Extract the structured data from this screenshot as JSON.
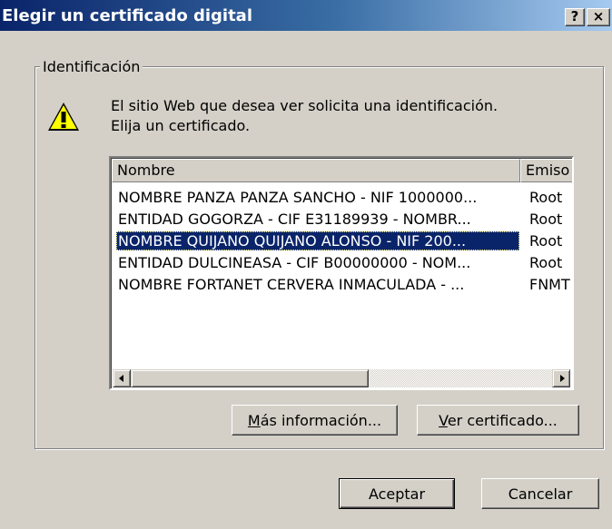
{
  "window": {
    "title": "Elegir un certificado digital",
    "help_button": "?",
    "close_button": "×"
  },
  "group": {
    "label": "Identificación",
    "message_line1": "El sitio Web que desea ver solicita una identificación.",
    "message_line2": "Elija un certificado."
  },
  "list": {
    "columns": [
      "Nombre",
      "Emiso"
    ],
    "rows": [
      {
        "name": "NOMBRE PANZA PANZA SANCHO - NIF 1000000...",
        "issuer": "Root",
        "selected": false
      },
      {
        "name": "ENTIDAD GOGORZA - CIF E31189939 - NOMBR...",
        "issuer": "Root",
        "selected": false
      },
      {
        "name": "NOMBRE QUIJANO QUIJANO ALONSO - NIF 200...",
        "issuer": "Root",
        "selected": true
      },
      {
        "name": "ENTIDAD DULCINEASA - CIF B00000000 - NOM...",
        "issuer": "Root",
        "selected": false
      },
      {
        "name": "NOMBRE FORTANET CERVERA INMACULADA - ...",
        "issuer": "FNMT",
        "selected": false
      }
    ]
  },
  "buttons": {
    "more_info_accel": "M",
    "more_info_rest": "ás información...",
    "view_cert_accel": "V",
    "view_cert_rest": "er certificado...",
    "ok": "Aceptar",
    "cancel": "Cancelar"
  },
  "colors": {
    "selection": "#0a246a",
    "face": "#d4d0c8",
    "title_start": "#0a246a",
    "title_end": "#a6caf0"
  }
}
